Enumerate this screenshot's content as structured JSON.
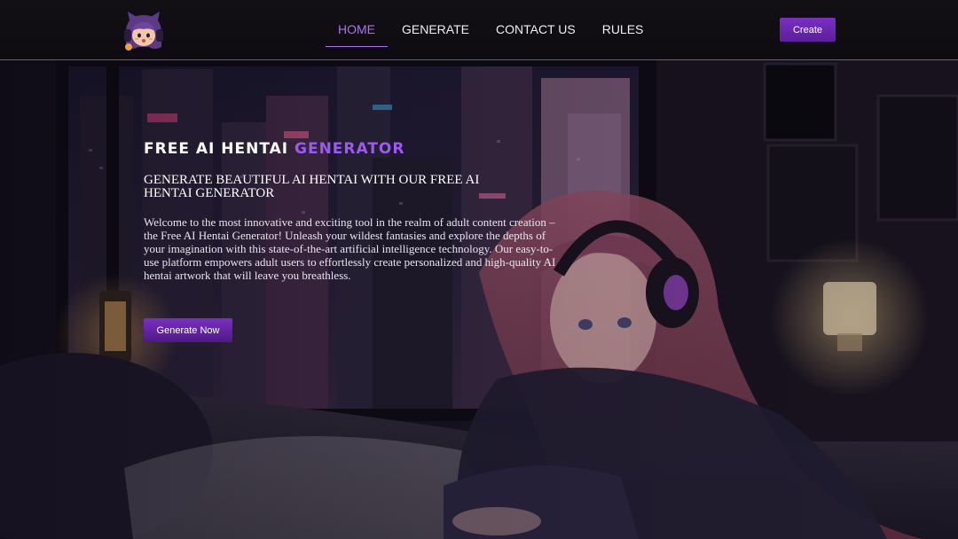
{
  "nav": {
    "items": [
      {
        "label": "HOME",
        "active": true
      },
      {
        "label": "GENERATE",
        "active": false
      },
      {
        "label": "CONTACT US",
        "active": false
      },
      {
        "label": "RULES",
        "active": false
      }
    ]
  },
  "header": {
    "create_label": "Create"
  },
  "hero": {
    "title_main": "FREE AI HENTAI ",
    "title_accent": "GENERATOR",
    "subtitle": "GENERATE BEAUTIFUL AI HENTAI WITH OUR FREE AI HENTAI GENERATOR",
    "description": "Welcome to the most innovative and exciting tool in the realm of adult content creation – the Free AI Hentai Generator! Unleash your wildest fantasies and explore the depths of your imagination with this state-of-the-art artificial intelligence technology. Our easy-to-use platform empowers adult users to effortlessly create personalized and high-quality AI hentai artwork that will leave you breathless.",
    "cta_label": "Generate Now"
  },
  "colors": {
    "accent": "#9b5bf0",
    "button": "#6a28b0",
    "header_bg": "#121015",
    "header_border": "#7a46c8"
  },
  "icons": {
    "logo": "anime-girl-avatar-logo"
  }
}
